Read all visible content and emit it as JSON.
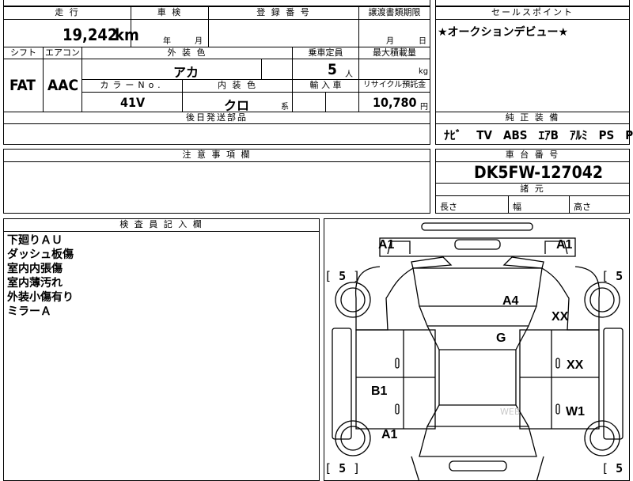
{
  "top": {
    "mileage_label": "走 行",
    "mileage_value": "19,242",
    "mileage_unit": "km",
    "inspection_label": "車 検",
    "inspection_year": "年",
    "inspection_month": "月",
    "registration_label": "登 録 番 号",
    "transfer_label": "譲渡書類期限",
    "transfer_month": "月",
    "transfer_day": "日"
  },
  "sales_point": {
    "label": "セールスポイント",
    "text": "★オークションデビュー★"
  },
  "specs": {
    "shift_label": "シフト",
    "shift_value": "FAT",
    "ac_label": "エアコン",
    "ac_value": "AAC",
    "exterior_label": "外 装 色",
    "exterior_value": "アカ",
    "capacity_label": "乗車定員",
    "capacity_value": "5",
    "capacity_unit": "人",
    "load_label": "最大積載量",
    "load_unit": "kg",
    "color_no_label": "カラーNo.",
    "color_no_value": "41V",
    "interior_label": "内 装 色",
    "interior_value": "クロ",
    "interior_suffix": "系",
    "import_label": "輸 入 車",
    "recycle_label": "リサイクル預託金",
    "recycle_value": "10,780",
    "recycle_unit": "円",
    "later_parts_label": "後日発送部品"
  },
  "equipment": {
    "label": "純 正 装 備",
    "items": [
      "ﾅﾋﾞ",
      "TV",
      "ABS",
      "ｴｱB",
      "ｱﾙﾐ",
      "PS",
      "PW"
    ]
  },
  "notes": {
    "label": "注 意 事 項 欄"
  },
  "chassis": {
    "label": "車 台 番 号",
    "value": "DK5FW-127042",
    "dims_label": "諸 元",
    "length_label": "長さ",
    "width_label": "幅",
    "height_label": "高さ"
  },
  "inspector": {
    "label": "検 査 員 記 入 欄",
    "lines": [
      "下廻りＡＵ",
      "ダッシュ板傷",
      "室内内張傷",
      "室内薄汚れ",
      "外装小傷有り",
      "ミラーＡ"
    ]
  },
  "diagram": {
    "marks": [
      "A1",
      "A1",
      "A4",
      "XX",
      "G",
      "XX",
      "B1",
      "W1",
      "A1"
    ],
    "tires": [
      "5",
      "5",
      "5",
      "5"
    ],
    "watermark": "WEB"
  }
}
